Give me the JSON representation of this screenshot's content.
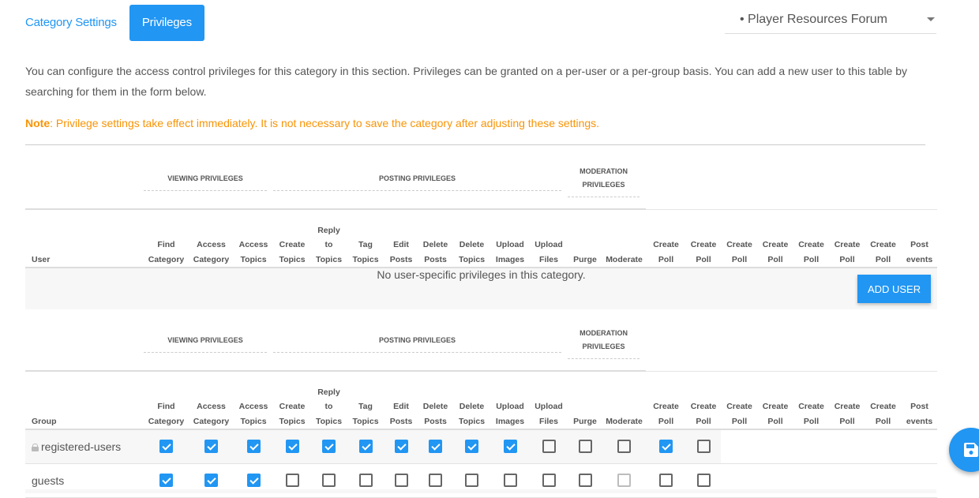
{
  "tabs": [
    {
      "label": "Category Settings",
      "active": false
    },
    {
      "label": "Privileges",
      "active": true
    }
  ],
  "category_select": {
    "selected": "• Player Resources Forum",
    "icon": "caret-down-icon"
  },
  "intro_text": "You can configure the access control privileges for this category in this section. Privileges can be granted on a per-user or a per-group basis. You can add a new user to this table by searching for them in the form below.",
  "note": {
    "label": "Note",
    "text": ": Privilege settings take effect immediately. It is not necessary to save the category after adjusting these settings."
  },
  "privilege_groups": {
    "viewing": "Viewing Privileges",
    "posting": "Posting Privileges",
    "moderation": "Moderation Privileges"
  },
  "columns": [
    [
      "Find",
      "Category"
    ],
    [
      "Access",
      "Category"
    ],
    [
      "Access",
      "Topics"
    ],
    [
      "Create",
      "Topics"
    ],
    [
      "Reply",
      "to",
      "Topics"
    ],
    [
      "Tag",
      "Topics"
    ],
    [
      "Edit",
      "Posts"
    ],
    [
      "Delete",
      "Posts"
    ],
    [
      "Delete",
      "Topics"
    ],
    [
      "Upload",
      "Images"
    ],
    [
      "Upload",
      "Files"
    ],
    [
      "Purge"
    ],
    [
      "Moderate"
    ],
    [
      "Create",
      "Poll"
    ],
    [
      "Create",
      "Poll"
    ],
    [
      "Create",
      "Poll"
    ],
    [
      "Create",
      "Poll"
    ],
    [
      "Create",
      "Poll"
    ],
    [
      "Create",
      "Poll"
    ],
    [
      "Create",
      "Poll"
    ],
    [
      "Post",
      "events"
    ]
  ],
  "user_table": {
    "first_col": "User",
    "empty_message": "No user-specific privileges in this category.",
    "add_user_label": "ADD USER"
  },
  "group_table": {
    "first_col": "Group",
    "rows": [
      {
        "name": "registered-users",
        "locked": true,
        "values": [
          true,
          true,
          true,
          true,
          true,
          true,
          true,
          true,
          true,
          true,
          false,
          false,
          false,
          true,
          false
        ],
        "disabled": [
          false,
          false,
          false,
          false,
          false,
          false,
          false,
          false,
          false,
          false,
          false,
          false,
          false,
          false,
          false
        ]
      },
      {
        "name": "guests",
        "locked": false,
        "values": [
          true,
          true,
          true,
          false,
          false,
          false,
          false,
          false,
          false,
          false,
          false,
          false,
          false,
          false,
          false
        ],
        "disabled": [
          false,
          false,
          false,
          false,
          false,
          false,
          false,
          false,
          false,
          false,
          false,
          false,
          true,
          false,
          false
        ]
      }
    ]
  },
  "fab": {
    "icon": "save-icon",
    "label": "Save"
  }
}
